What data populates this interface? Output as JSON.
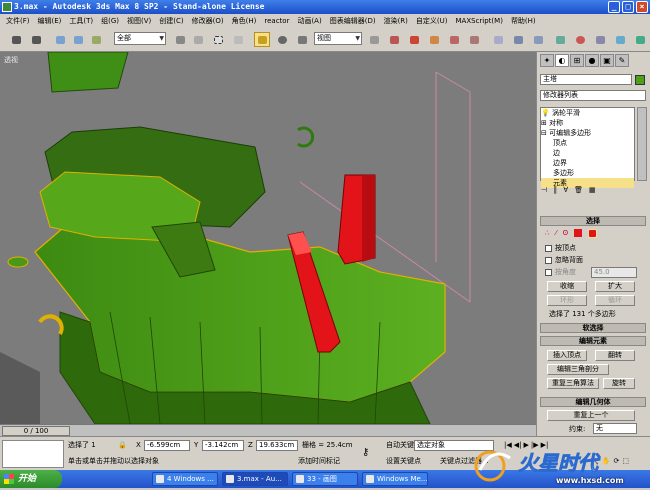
{
  "window": {
    "title": "3.max - Autodesk 3ds Max 8 SP2 - Stand-alone License"
  },
  "menu": [
    "文件(F)",
    "编辑(E)",
    "工具(T)",
    "组(G)",
    "视图(V)",
    "创建(C)",
    "修改器(O)",
    "角色(H)",
    "reactor",
    "动画(A)",
    "图表编辑器(D)",
    "渲染(R)",
    "自定义(U)",
    "MAXScript(M)",
    "帮助(H)"
  ],
  "toolbar": {
    "selection_filter": "全部",
    "ref_coord": "视图"
  },
  "viewport": {
    "label": "透视"
  },
  "timeline": {
    "frame": "0 / 100"
  },
  "command_panel": {
    "object_name": "主塔",
    "modifier_list": "修改器列表",
    "stack": [
      "涡轮平滑",
      "对称",
      "可编辑多边形",
      "顶点",
      "边",
      "边界",
      "多边形",
      "元素"
    ],
    "selection": {
      "header": "选择",
      "by_vertex": "按顶点",
      "ignore_backfacing": "忽略背面",
      "by_angle": "按角度",
      "angle_value": "45.0",
      "shrink": "收缩",
      "grow": "扩大",
      "ring": "环形",
      "loop": "循环",
      "status": "选择了 131 个多边形"
    },
    "soft_selection": "软选择",
    "edit_elements": {
      "header": "编辑元素",
      "insert_vertex": "插入顶点",
      "flip": "翻转",
      "edit_tri": "编辑三角剖分",
      "retri": "重复三角算法",
      "turn": "旋转"
    },
    "edit_geometry": {
      "header": "编辑几何体",
      "repeat_last": "重复上一个",
      "constraints": "约束:",
      "constraint_value": "无"
    }
  },
  "status": {
    "selected": "选择了 1",
    "x_label": "X",
    "x": "-6.599cm",
    "y_label": "Y",
    "y": "-3.142cm",
    "z_label": "Z",
    "z": "19.633cm",
    "grid": "栅格 = 25.4cm",
    "prompt": "单击或单击并拖动以选择对象",
    "add_time_tag": "添加时间标记",
    "auto_key": "自动关键点",
    "set_key": "设置关键点",
    "selected_obj": "选定对象",
    "key_filters": "关键点过滤器..."
  },
  "taskbar": {
    "start": "开始",
    "tasks": [
      "4 Windows ...",
      "3.max - Au...",
      "33 - 画图",
      "Windows Me..."
    ],
    "domain": "www.hxsd.com"
  },
  "colors": {
    "model_green": "#4ea01a",
    "selected_red": "#e2141a",
    "accent": "#2352c9"
  }
}
